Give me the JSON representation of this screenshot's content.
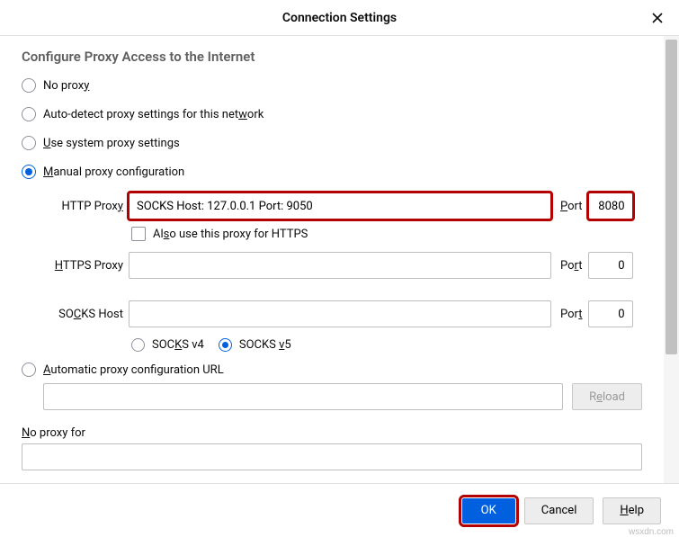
{
  "title": "Connection Settings",
  "heading": "Configure Proxy Access to the Internet",
  "options": {
    "no_proxy": {
      "pre": "No prox",
      "key": "y",
      "post": ""
    },
    "auto_detect": {
      "pre": "Auto-detect proxy settings for this net",
      "key": "w",
      "post": "ork"
    },
    "use_system": {
      "pre": "",
      "key": "U",
      "post": "se system proxy settings"
    },
    "manual": {
      "pre": "",
      "key": "M",
      "post": "anual proxy configuration"
    },
    "auto_url": {
      "pre": "",
      "key": "A",
      "post": "utomatic proxy configuration URL"
    }
  },
  "http": {
    "label_pre": "HTTP Prox",
    "label_key": "y",
    "value": "SOCKS Host: 127.0.0.1 Port: 9050",
    "port_label_key": "P",
    "port_label_post": "ort",
    "port": "8080"
  },
  "also_https": {
    "pre": "Al",
    "key": "s",
    "post": "o use this proxy for HTTPS"
  },
  "https": {
    "label_key": "H",
    "label_post": "TTPS Proxy",
    "value": "",
    "port_label_pre": "Po",
    "port_label_key": "r",
    "port_label_post": "t",
    "port": "0"
  },
  "socks": {
    "label_pre": "SO",
    "label_key": "C",
    "label_post": "KS Host",
    "value": "",
    "port_label_pre": "Por",
    "port_label_key": "t",
    "port_label_post": "",
    "port": "0",
    "v4_pre": "SOC",
    "v4_key": "K",
    "v4_post": "S v4",
    "v5_pre": "SOCKS ",
    "v5_key": "v",
    "v5_post": "5"
  },
  "reload": {
    "pre": "R",
    "key": "e",
    "post": "load"
  },
  "no_proxy_for": {
    "key": "N",
    "post": "o proxy for"
  },
  "buttons": {
    "ok": "OK",
    "cancel": "Cancel",
    "help_key": "H",
    "help_post": "elp"
  },
  "watermark": "wsxdn.com"
}
